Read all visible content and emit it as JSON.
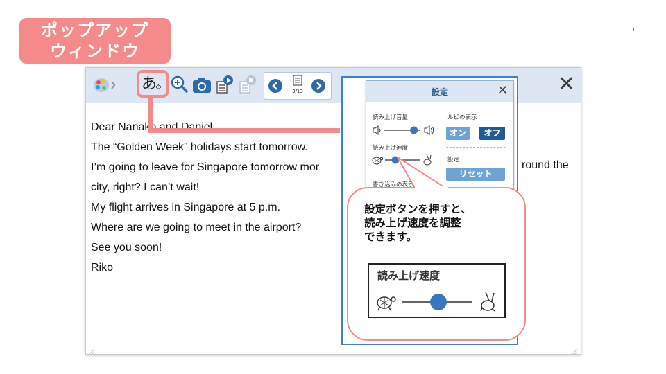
{
  "badge": {
    "line1": "ポップアップ",
    "line2": "ウィンドウ"
  },
  "toolbar": {
    "ruby_glyph": "あ",
    "page_indicator": "3/13",
    "close_glyph": "✕"
  },
  "letter": {
    "lines": [
      "Dear Nanako and Daniel,",
      "The “Golden Week” holidays start tomorrow.",
      "I’m going to leave for Singapore tomorrow mor",
      "city, right?   I can’t wait!",
      "My flight arrives in Singapore at 5 p.m.",
      "Where are we going to meet in the airport?",
      "See you soon!",
      "Riko"
    ],
    "overflow_text": "round the"
  },
  "settings": {
    "title": "設定",
    "close_glyph": "✕",
    "volume_label": "読み上げ音量",
    "ruby_label": "ルビの表示",
    "ruby_on": "オン",
    "ruby_off": "オフ",
    "speed_label": "読み上げ速度",
    "reset_section_label": "設定",
    "reset_button": "リセット",
    "writing_label": "書き込みの表示",
    "volume_level": 0.82,
    "speed_level": 0.3
  },
  "callout": {
    "line1": "設定ボタンを押すと、",
    "line2": "読み上げ速度を調整",
    "line3": "できます。",
    "speed_box_label": "読み上げ速度",
    "speed_level": 0.52
  },
  "colors": {
    "accent_pink": "#f48a8a",
    "toolbar_bg": "#dce7f3",
    "blue": "#3d83c3",
    "dark_blue": "#1b5d94",
    "slider_blue": "#3a76bf"
  }
}
